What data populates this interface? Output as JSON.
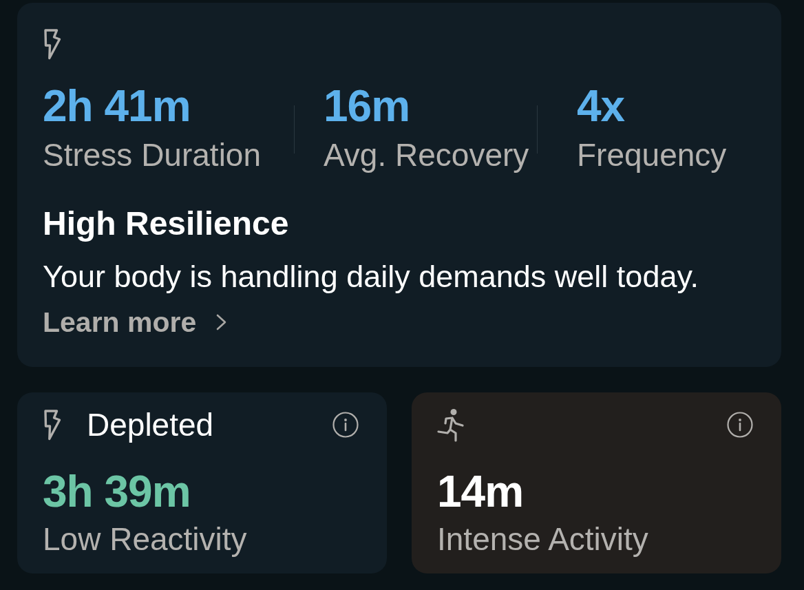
{
  "summary": {
    "metrics": [
      {
        "value": "2h 41m",
        "label": "Stress Duration"
      },
      {
        "value": "16m",
        "label": "Avg. Recovery"
      },
      {
        "value": "4x",
        "label": "Frequency"
      }
    ],
    "title": "High Resilience",
    "description": "Your body is handling daily demands well today.",
    "link": "Learn more"
  },
  "cards": [
    {
      "kind": "stress",
      "title": "Depleted",
      "value": "3h 39m",
      "label": "Low Reactivity",
      "color": "#6cc5a5"
    },
    {
      "kind": "activity",
      "value": "14m",
      "label": "Intense Activity",
      "color": "#ffffff"
    }
  ]
}
